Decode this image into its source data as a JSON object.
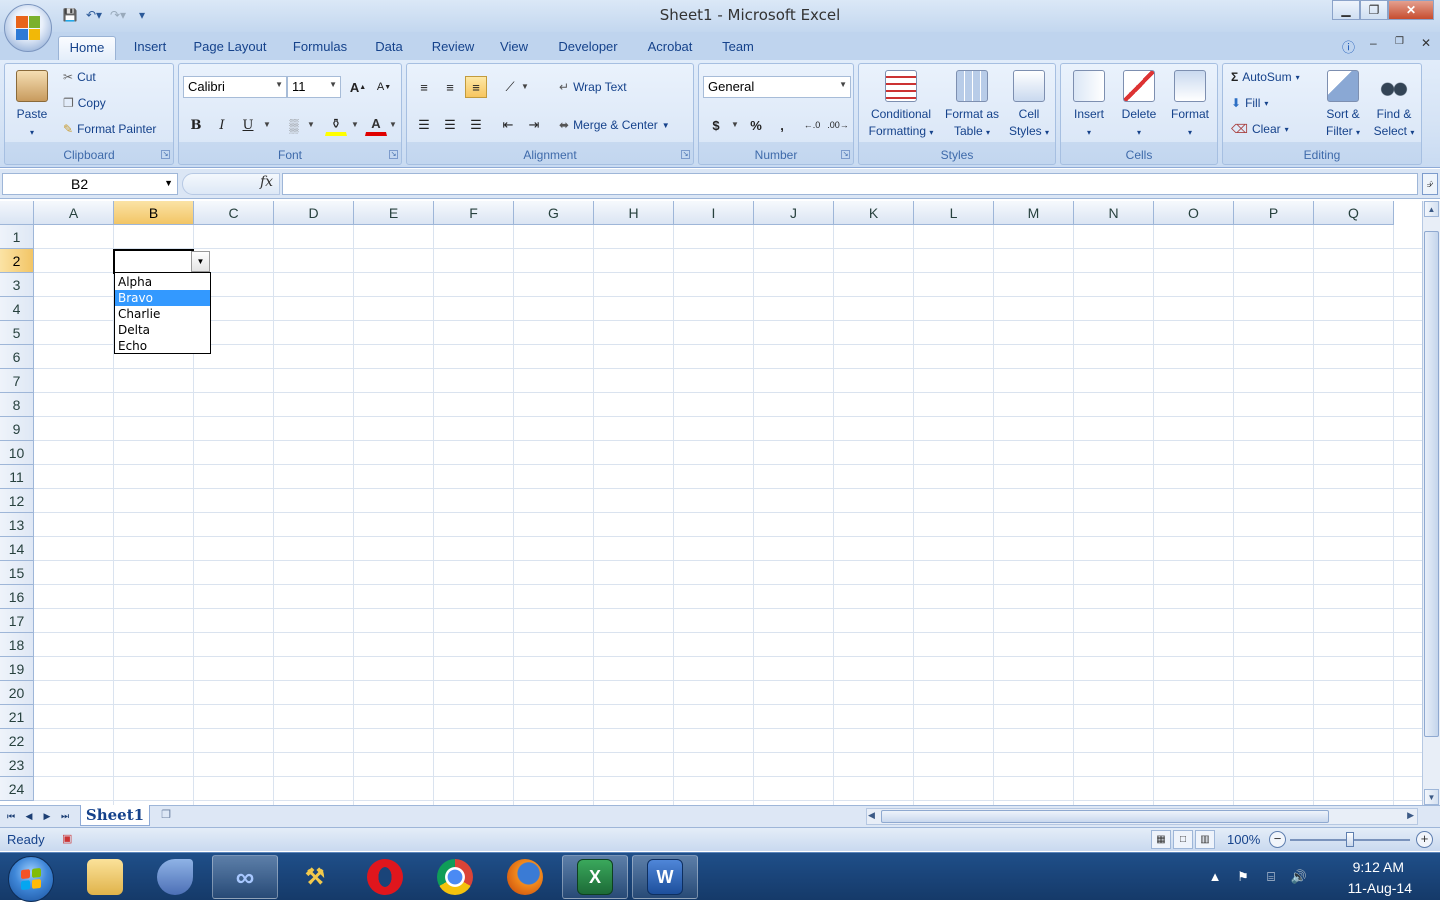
{
  "window": {
    "title": "Sheet1 - Microsoft Excel"
  },
  "qat": {
    "items": [
      "save",
      "undo",
      "redo",
      "customize"
    ]
  },
  "tabs": [
    "Home",
    "Insert",
    "Page Layout",
    "Formulas",
    "Data",
    "Review",
    "View",
    "Developer",
    "Acrobat",
    "Team"
  ],
  "active_tab": "Home",
  "ribbon": {
    "clipboard": {
      "label": "Clipboard",
      "paste": "Paste",
      "cut": "Cut",
      "copy": "Copy",
      "format_painter": "Format Painter"
    },
    "font": {
      "label": "Font",
      "name": "Calibri",
      "size": "11",
      "bold": "B",
      "italic": "I",
      "underline": "U",
      "grow": "A",
      "shrink": "A",
      "font_color": "A"
    },
    "alignment": {
      "label": "Alignment",
      "wrap_text": "Wrap Text",
      "merge_center": "Merge & Center"
    },
    "number": {
      "label": "Number",
      "format": "General",
      "currency": "$",
      "percent": "%",
      "comma": ","
    },
    "styles": {
      "label": "Styles",
      "conditional_1": "Conditional",
      "conditional_2": "Formatting",
      "format_table_1": "Format as",
      "format_table_2": "Table",
      "cell_styles_1": "Cell",
      "cell_styles_2": "Styles"
    },
    "cells": {
      "label": "Cells",
      "insert": "Insert",
      "delete": "Delete",
      "format": "Format"
    },
    "editing": {
      "label": "Editing",
      "autosum": "AutoSum",
      "fill": "Fill",
      "clear": "Clear",
      "sort_1": "Sort &",
      "sort_2": "Filter",
      "find_1": "Find &",
      "find_2": "Select"
    }
  },
  "formula_bar": {
    "name_box": "B2",
    "fx": "fx",
    "formula": ""
  },
  "columns": [
    "A",
    "B",
    "C",
    "D",
    "E",
    "F",
    "G",
    "H",
    "I",
    "J",
    "K",
    "L",
    "M",
    "N",
    "O",
    "P",
    "Q"
  ],
  "rows": [
    "1",
    "2",
    "3",
    "4",
    "5",
    "6",
    "7",
    "8",
    "9",
    "10",
    "11",
    "12",
    "13",
    "14",
    "15",
    "16",
    "17",
    "18",
    "19",
    "20",
    "21",
    "22",
    "23",
    "24"
  ],
  "active_cell": "B2",
  "selected_column": "B",
  "selected_row": "2",
  "dropdown": {
    "options": [
      "Alpha",
      "Bravo",
      "Charlie",
      "Delta",
      "Echo"
    ],
    "highlighted": "Bravo"
  },
  "sheets": {
    "tabs": [
      "Sheet1"
    ],
    "active": "Sheet1"
  },
  "status": {
    "text": "Ready",
    "zoom": "100%"
  },
  "taskbar": {
    "apps": [
      "explorer",
      "dolphin",
      "infinity",
      "tools",
      "opera",
      "chrome",
      "firefox",
      "excel",
      "word"
    ],
    "time": "9:12 AM",
    "date": "11-Aug-14"
  },
  "colors": {
    "accent": "#15428b",
    "selected_header": "#f2c566",
    "highlight": "#3399ff"
  }
}
